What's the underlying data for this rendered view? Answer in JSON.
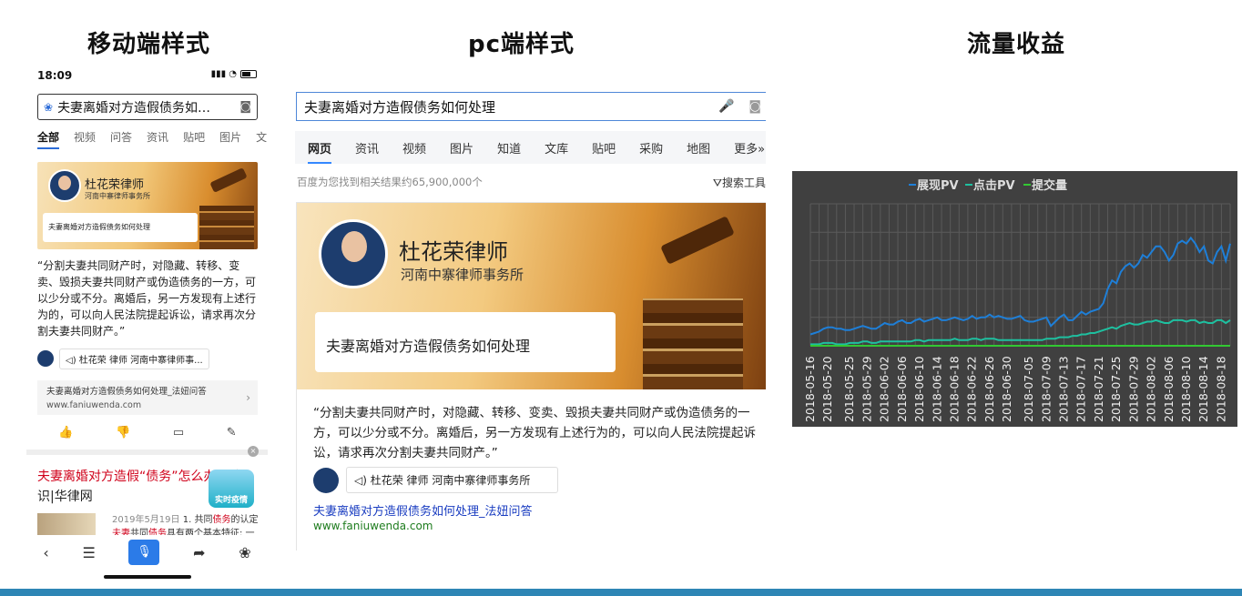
{
  "headings": {
    "mobile": "移动端样式",
    "pc": "pc端样式",
    "traffic": "流量收益"
  },
  "mobile": {
    "status_time": "18:09",
    "status_signal": "▮▮▮ ◔",
    "search_query": "夫妻离婚对方造假债务如…",
    "search_icon": "paw-icon",
    "camera_icon": "camera-icon",
    "tabs": [
      "全部",
      "视频",
      "问答",
      "资讯",
      "贴吧",
      "图片",
      "文"
    ],
    "banner": {
      "lawyer": "杜花荣律师",
      "firm": "河南中寨律师事务所",
      "bubble": "夫妻离婚对方造假债务如何处理"
    },
    "answer_text": "“分割夫妻共同财产时，对隐藏、转移、变卖、毁损夫妻共同财产或伪造债务的一方，可以少分或不分。离婚后，另一方发现有上述行为的，可以向人民法院提起诉讼，请求再次分割夫妻共同财产。”",
    "author": "杜花荣   律师   河南中寨律师事...",
    "source_title": "夫妻离婚对方造假债务如何处理_法妞问答",
    "source_url": "www.faniuwenda.com",
    "result_title_hl": "夫妻离婚对方造假“债务”怎么办",
    "result_title_rest": "?...知识|华律网",
    "result_date": "2019年5月19日",
    "result_snippet_1": " 1. 共同",
    "result_snippet_hl_1": "债务",
    "result_snippet_2": "的认定",
    "result_snippet_hl_2": "夫妻",
    "result_snippet_3": "共同",
    "result_snippet_hl_3": "债务",
    "result_snippet_4": "具有两个基本特征: 一",
    "epidemic_badge": "实时疫情",
    "close": "×"
  },
  "pc": {
    "search_query": "夫妻离婚对方造假债务如何处理",
    "tabs": [
      "网页",
      "资讯",
      "视频",
      "图片",
      "知道",
      "文库",
      "贴吧",
      "采购",
      "地图",
      "更多»"
    ],
    "result_count": "百度为您找到相关结果约65,900,000个",
    "search_tools": "搜索工具",
    "banner": {
      "lawyer": "杜花荣律师",
      "firm": "河南中寨律师事务所",
      "bubble": "夫妻离婚对方造假债务如何处理"
    },
    "answer_text": "“分割夫妻共同财产时，对隐藏、转移、变卖、毁损夫妻共同财产或伪造债务的一方，可以少分或不分。离婚后，另一方发现有上述行为的，可以向人民法院提起诉讼，请求再次分割夫妻共同财产。”",
    "author": "杜花荣    律师    河南中寨律师事务所",
    "link_title": "夫妻离婚对方造假债务如何处理_法妞问答",
    "link_url": "www.faniuwenda.com"
  },
  "chart_data": {
    "type": "line",
    "title": "",
    "legend_position": "top-center",
    "grid": true,
    "x": [
      "2018-05-16",
      "2018-05-17",
      "2018-05-18",
      "2018-05-19",
      "2018-05-20",
      "2018-05-21",
      "2018-05-22",
      "2018-05-23",
      "2018-05-24",
      "2018-05-25",
      "2018-05-26",
      "2018-05-27",
      "2018-05-28",
      "2018-05-29",
      "2018-05-30",
      "2018-05-31",
      "2018-06-01",
      "2018-06-02",
      "2018-06-03",
      "2018-06-04",
      "2018-06-05",
      "2018-06-06",
      "2018-06-07",
      "2018-06-08",
      "2018-06-09",
      "2018-06-10",
      "2018-06-11",
      "2018-06-12",
      "2018-06-13",
      "2018-06-14",
      "2018-06-15",
      "2018-06-16",
      "2018-06-17",
      "2018-06-18",
      "2018-06-19",
      "2018-06-20",
      "2018-06-21",
      "2018-06-22",
      "2018-06-23",
      "2018-06-24",
      "2018-06-25",
      "2018-06-26",
      "2018-06-27",
      "2018-06-28",
      "2018-06-29",
      "2018-06-30",
      "2018-07-01",
      "2018-07-02",
      "2018-07-03",
      "2018-07-04",
      "2018-07-05",
      "2018-07-06",
      "2018-07-07",
      "2018-07-08",
      "2018-07-09",
      "2018-07-10",
      "2018-07-11",
      "2018-07-12",
      "2018-07-13",
      "2018-07-14",
      "2018-07-15",
      "2018-07-16",
      "2018-07-17",
      "2018-07-18",
      "2018-07-19",
      "2018-07-20",
      "2018-07-21",
      "2018-07-22",
      "2018-07-23",
      "2018-07-24",
      "2018-07-25",
      "2018-07-26",
      "2018-07-27",
      "2018-07-28",
      "2018-07-29",
      "2018-07-30",
      "2018-07-31",
      "2018-08-01",
      "2018-08-02",
      "2018-08-03",
      "2018-08-04",
      "2018-08-05",
      "2018-08-06",
      "2018-08-07",
      "2018-08-08",
      "2018-08-09",
      "2018-08-10",
      "2018-08-11",
      "2018-08-12",
      "2018-08-13",
      "2018-08-14",
      "2018-08-15",
      "2018-08-16",
      "2018-08-17",
      "2018-08-18",
      "2018-08-19",
      "2018-08-20"
    ],
    "tick_labels": [
      "2018-05-16",
      "2018-05-20",
      "2018-05-25",
      "2018-05-29",
      "2018-06-02",
      "2018-06-06",
      "2018-06-10",
      "2018-06-14",
      "2018-06-18",
      "2018-06-22",
      "2018-06-26",
      "2018-06-30",
      "2018-07-05",
      "2018-07-09",
      "2018-07-13",
      "2018-07-17",
      "2018-07-21",
      "2018-07-25",
      "2018-07-29",
      "2018-08-02",
      "2018-08-06",
      "2018-08-10",
      "2018-08-14",
      "2018-08-18"
    ],
    "series": [
      {
        "name": "展现PV",
        "color": "#1e7fd8",
        "values": [
          8,
          9,
          10,
          12,
          13,
          13,
          12,
          12,
          11,
          11,
          12,
          13,
          14,
          13,
          12,
          12,
          14,
          16,
          15,
          15,
          17,
          18,
          16,
          16,
          18,
          19,
          17,
          18,
          19,
          20,
          18,
          18,
          19,
          20,
          19,
          18,
          19,
          21,
          19,
          20,
          20,
          22,
          20,
          21,
          20,
          19,
          19,
          20,
          21,
          18,
          17,
          17,
          18,
          19,
          20,
          14,
          17,
          20,
          22,
          18,
          18,
          21,
          24,
          22,
          24,
          25,
          26,
          30,
          40,
          46,
          44,
          52,
          56,
          58,
          55,
          58,
          64,
          62,
          66,
          70,
          70,
          66,
          60,
          64,
          72,
          74,
          72,
          76,
          72,
          66,
          70,
          60,
          58,
          66,
          70,
          60,
          72
        ]
      },
      {
        "name": "点击PV",
        "color": "#1ec0a0",
        "values": [
          1,
          1,
          1,
          2,
          2,
          2,
          1,
          1,
          1,
          2,
          2,
          2,
          3,
          3,
          2,
          2,
          3,
          3,
          3,
          3,
          3,
          3,
          3,
          3,
          4,
          4,
          3,
          4,
          4,
          4,
          4,
          4,
          4,
          5,
          4,
          4,
          4,
          5,
          5,
          4,
          5,
          5,
          5,
          4,
          4,
          4,
          4,
          4,
          4,
          4,
          4,
          4,
          4,
          4,
          5,
          5,
          5,
          6,
          6,
          6,
          7,
          7,
          8,
          8,
          9,
          9,
          10,
          11,
          12,
          13,
          12,
          14,
          15,
          16,
          15,
          15,
          16,
          17,
          17,
          18,
          17,
          16,
          16,
          18,
          18,
          18,
          17,
          18,
          18,
          16,
          17,
          16,
          16,
          18,
          18,
          16,
          18
        ]
      },
      {
        "name": "提交量",
        "color": "#32c832",
        "values": [
          0,
          0,
          0,
          0,
          0,
          0,
          0,
          0,
          0,
          0,
          0,
          0,
          0,
          0,
          0,
          0,
          0,
          0,
          0,
          0,
          0,
          0,
          0,
          0,
          0,
          0,
          0,
          0,
          0,
          0,
          0,
          0,
          0,
          0,
          0,
          0,
          0,
          0,
          0,
          0,
          0,
          0,
          0,
          0,
          0,
          0,
          0,
          0,
          0,
          0,
          0,
          0,
          0,
          0,
          0,
          0,
          0,
          0,
          0,
          0,
          0,
          0,
          0,
          0,
          0,
          0,
          0,
          0,
          0,
          0,
          0,
          0,
          0,
          0,
          0,
          0,
          0,
          0,
          0,
          0,
          0,
          0,
          0,
          0,
          0,
          0,
          0,
          0,
          0,
          0,
          0,
          0,
          0,
          0,
          0,
          0,
          0
        ]
      }
    ],
    "ylim": [
      0,
      100
    ]
  }
}
